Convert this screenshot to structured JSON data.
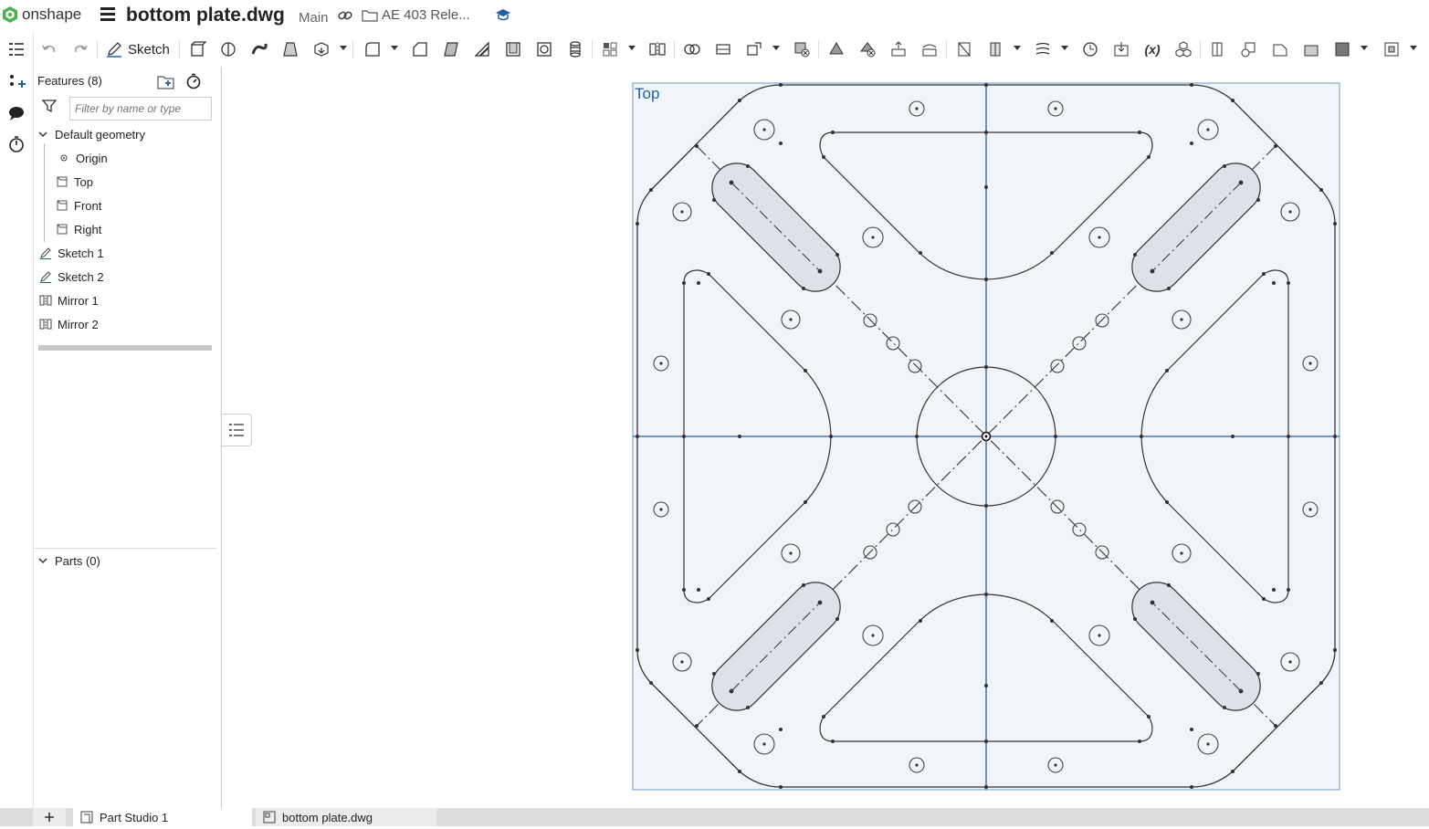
{
  "header": {
    "brand": "onshape",
    "document_title": "bottom plate.dwg",
    "branch": "Main",
    "folder_label": "AE 403 Rele..."
  },
  "toolbar": {
    "sketch_label": "Sketch"
  },
  "feature_panel": {
    "features_label": "Features (8)",
    "filter_placeholder": "Filter by name or type",
    "default_geometry_label": "Default geometry",
    "items": [
      {
        "label": "Origin",
        "icon": "origin-icon"
      },
      {
        "label": "Top",
        "icon": "plane-icon"
      },
      {
        "label": "Front",
        "icon": "plane-icon"
      },
      {
        "label": "Right",
        "icon": "plane-icon"
      },
      {
        "label": "Sketch 1",
        "icon": "sketch-icon"
      },
      {
        "label": "Sketch 2",
        "icon": "sketch-icon"
      },
      {
        "label": "Mirror 1",
        "icon": "mirror-icon"
      },
      {
        "label": "Mirror 2",
        "icon": "mirror-icon"
      }
    ],
    "parts_label": "Parts (0)"
  },
  "viewport": {
    "view_label": "Top"
  },
  "tabs": [
    {
      "label": "Part Studio 1",
      "active": true
    },
    {
      "label": "bottom plate.dwg",
      "active": false
    }
  ],
  "colors": {
    "accent": "#1f5fa6",
    "sketch_line": "#333333",
    "construction": "#4a7ab5",
    "plane_fill": "#f1f5f9",
    "slot_fill": "#dde2e8"
  }
}
